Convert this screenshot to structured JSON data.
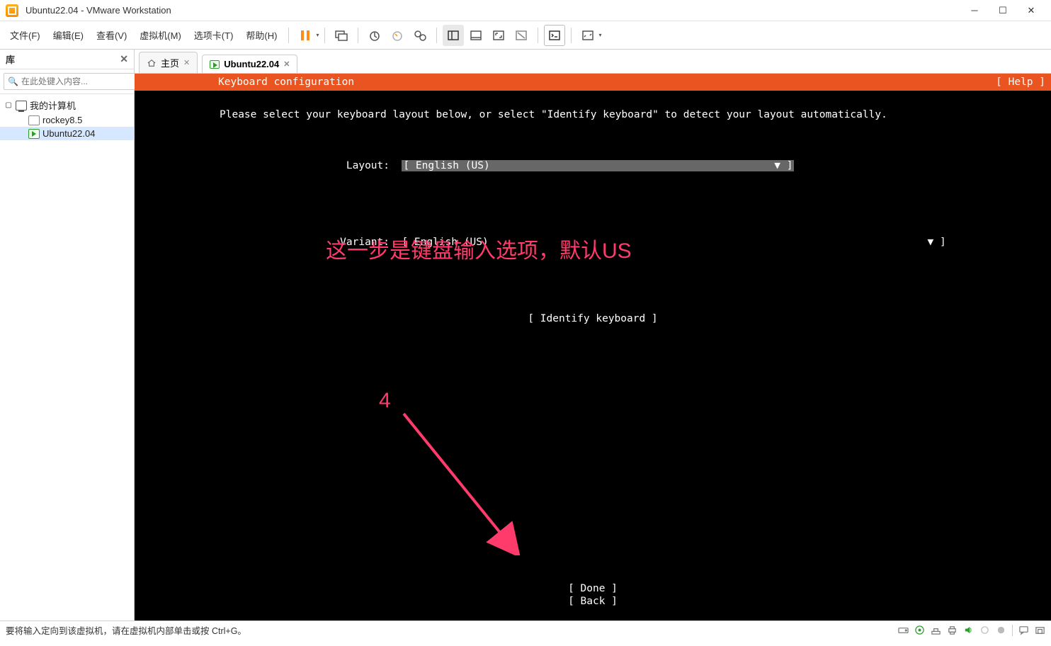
{
  "window": {
    "title": "Ubuntu22.04 - VMware Workstation"
  },
  "menus": {
    "file": "文件(F)",
    "edit": "编辑(E)",
    "view": "查看(V)",
    "vm": "虚拟机(M)",
    "tabs": "选项卡(T)",
    "help": "帮助(H)"
  },
  "sidebar": {
    "header": "库",
    "search_placeholder": "在此处键入内容...",
    "root": "我的计算机",
    "items": [
      {
        "label": "rockey8.5",
        "running": false
      },
      {
        "label": "Ubuntu22.04",
        "running": true
      }
    ]
  },
  "tabs": {
    "home": "主页",
    "vm": "Ubuntu22.04"
  },
  "installer": {
    "title": "Keyboard configuration",
    "help": "[ Help ]",
    "instruction": "Please select your keyboard layout below, or select \"Identify keyboard\" to detect your layout automatically.",
    "layout_label": "Layout:",
    "layout_value": "[ English (US)",
    "layout_tail": "▼ ]",
    "variant_label": "Variant:",
    "variant_value": "[ English (US)",
    "variant_tail": "▼ ]",
    "identify": "[ Identify keyboard ]",
    "done": "[ Done         ]",
    "back": "[ Back         ]"
  },
  "annotation": {
    "text": "这一步是键盘输入选项，默认US",
    "number": "4"
  },
  "statusbar": {
    "hint": "要将输入定向到该虚拟机，请在虚拟机内部单击或按 Ctrl+G。"
  }
}
